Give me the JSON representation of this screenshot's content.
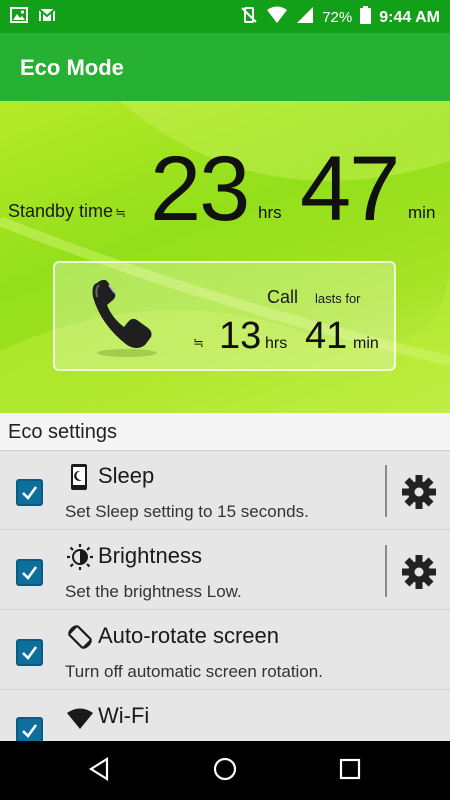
{
  "status_bar": {
    "battery_percent": "72%",
    "time": "9:44 AM",
    "icons": [
      "image-icon",
      "gmail-icon",
      "vibrate-off-icon",
      "wifi-icon",
      "signal-icon",
      "battery-icon"
    ]
  },
  "app_bar": {
    "title": "Eco Mode"
  },
  "standby": {
    "label": "Standby time",
    "approx_symbol": "≒",
    "hours": "23",
    "hours_unit": "hrs",
    "minutes": "47",
    "minutes_unit": "min"
  },
  "call": {
    "label": "Call",
    "lasts_label": "lasts for",
    "approx_symbol": "≒",
    "hours": "13",
    "hours_unit": "hrs",
    "minutes": "41",
    "minutes_unit": "min"
  },
  "section": {
    "title": "Eco settings"
  },
  "settings": [
    {
      "title": "Sleep",
      "subtitle": "Set Sleep setting to 15 seconds.",
      "checked": true,
      "has_gear": true,
      "icon": "sleep-phone-icon"
    },
    {
      "title": "Brightness",
      "subtitle": "Set the brightness Low.",
      "checked": true,
      "has_gear": true,
      "icon": "brightness-icon"
    },
    {
      "title": "Auto-rotate screen",
      "subtitle": "Turn off automatic screen rotation.",
      "checked": true,
      "has_gear": false,
      "icon": "rotate-icon"
    },
    {
      "title": "Wi-Fi",
      "subtitle": "",
      "checked": true,
      "has_gear": false,
      "icon": "wifi-icon"
    }
  ],
  "nav_bar": {
    "buttons": [
      "back-icon",
      "home-icon",
      "recents-icon"
    ]
  },
  "colors": {
    "status_bar": "#13a019",
    "app_bar": "#27b132",
    "checkbox": "#0f6f9c",
    "hero": "#a6e324"
  }
}
